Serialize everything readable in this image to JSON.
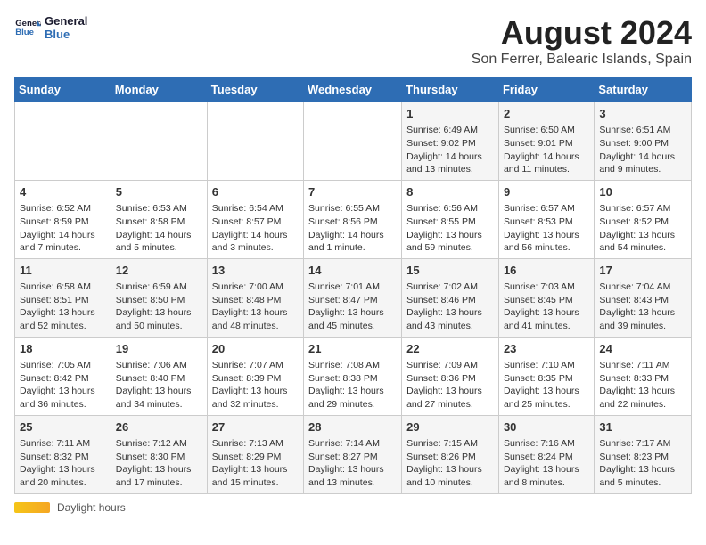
{
  "header": {
    "logo_line1": "General",
    "logo_line2": "Blue",
    "title": "August 2024",
    "subtitle": "Son Ferrer, Balearic Islands, Spain"
  },
  "days_of_week": [
    "Sunday",
    "Monday",
    "Tuesday",
    "Wednesday",
    "Thursday",
    "Friday",
    "Saturday"
  ],
  "weeks": [
    [
      {
        "day": "",
        "content": ""
      },
      {
        "day": "",
        "content": ""
      },
      {
        "day": "",
        "content": ""
      },
      {
        "day": "",
        "content": ""
      },
      {
        "day": "1",
        "content": "Sunrise: 6:49 AM\nSunset: 9:02 PM\nDaylight: 14 hours and 13 minutes."
      },
      {
        "day": "2",
        "content": "Sunrise: 6:50 AM\nSunset: 9:01 PM\nDaylight: 14 hours and 11 minutes."
      },
      {
        "day": "3",
        "content": "Sunrise: 6:51 AM\nSunset: 9:00 PM\nDaylight: 14 hours and 9 minutes."
      }
    ],
    [
      {
        "day": "4",
        "content": "Sunrise: 6:52 AM\nSunset: 8:59 PM\nDaylight: 14 hours and 7 minutes."
      },
      {
        "day": "5",
        "content": "Sunrise: 6:53 AM\nSunset: 8:58 PM\nDaylight: 14 hours and 5 minutes."
      },
      {
        "day": "6",
        "content": "Sunrise: 6:54 AM\nSunset: 8:57 PM\nDaylight: 14 hours and 3 minutes."
      },
      {
        "day": "7",
        "content": "Sunrise: 6:55 AM\nSunset: 8:56 PM\nDaylight: 14 hours and 1 minute."
      },
      {
        "day": "8",
        "content": "Sunrise: 6:56 AM\nSunset: 8:55 PM\nDaylight: 13 hours and 59 minutes."
      },
      {
        "day": "9",
        "content": "Sunrise: 6:57 AM\nSunset: 8:53 PM\nDaylight: 13 hours and 56 minutes."
      },
      {
        "day": "10",
        "content": "Sunrise: 6:57 AM\nSunset: 8:52 PM\nDaylight: 13 hours and 54 minutes."
      }
    ],
    [
      {
        "day": "11",
        "content": "Sunrise: 6:58 AM\nSunset: 8:51 PM\nDaylight: 13 hours and 52 minutes."
      },
      {
        "day": "12",
        "content": "Sunrise: 6:59 AM\nSunset: 8:50 PM\nDaylight: 13 hours and 50 minutes."
      },
      {
        "day": "13",
        "content": "Sunrise: 7:00 AM\nSunset: 8:48 PM\nDaylight: 13 hours and 48 minutes."
      },
      {
        "day": "14",
        "content": "Sunrise: 7:01 AM\nSunset: 8:47 PM\nDaylight: 13 hours and 45 minutes."
      },
      {
        "day": "15",
        "content": "Sunrise: 7:02 AM\nSunset: 8:46 PM\nDaylight: 13 hours and 43 minutes."
      },
      {
        "day": "16",
        "content": "Sunrise: 7:03 AM\nSunset: 8:45 PM\nDaylight: 13 hours and 41 minutes."
      },
      {
        "day": "17",
        "content": "Sunrise: 7:04 AM\nSunset: 8:43 PM\nDaylight: 13 hours and 39 minutes."
      }
    ],
    [
      {
        "day": "18",
        "content": "Sunrise: 7:05 AM\nSunset: 8:42 PM\nDaylight: 13 hours and 36 minutes."
      },
      {
        "day": "19",
        "content": "Sunrise: 7:06 AM\nSunset: 8:40 PM\nDaylight: 13 hours and 34 minutes."
      },
      {
        "day": "20",
        "content": "Sunrise: 7:07 AM\nSunset: 8:39 PM\nDaylight: 13 hours and 32 minutes."
      },
      {
        "day": "21",
        "content": "Sunrise: 7:08 AM\nSunset: 8:38 PM\nDaylight: 13 hours and 29 minutes."
      },
      {
        "day": "22",
        "content": "Sunrise: 7:09 AM\nSunset: 8:36 PM\nDaylight: 13 hours and 27 minutes."
      },
      {
        "day": "23",
        "content": "Sunrise: 7:10 AM\nSunset: 8:35 PM\nDaylight: 13 hours and 25 minutes."
      },
      {
        "day": "24",
        "content": "Sunrise: 7:11 AM\nSunset: 8:33 PM\nDaylight: 13 hours and 22 minutes."
      }
    ],
    [
      {
        "day": "25",
        "content": "Sunrise: 7:11 AM\nSunset: 8:32 PM\nDaylight: 13 hours and 20 minutes."
      },
      {
        "day": "26",
        "content": "Sunrise: 7:12 AM\nSunset: 8:30 PM\nDaylight: 13 hours and 17 minutes."
      },
      {
        "day": "27",
        "content": "Sunrise: 7:13 AM\nSunset: 8:29 PM\nDaylight: 13 hours and 15 minutes."
      },
      {
        "day": "28",
        "content": "Sunrise: 7:14 AM\nSunset: 8:27 PM\nDaylight: 13 hours and 13 minutes."
      },
      {
        "day": "29",
        "content": "Sunrise: 7:15 AM\nSunset: 8:26 PM\nDaylight: 13 hours and 10 minutes."
      },
      {
        "day": "30",
        "content": "Sunrise: 7:16 AM\nSunset: 8:24 PM\nDaylight: 13 hours and 8 minutes."
      },
      {
        "day": "31",
        "content": "Sunrise: 7:17 AM\nSunset: 8:23 PM\nDaylight: 13 hours and 5 minutes."
      }
    ]
  ],
  "footer": {
    "daylight_label": "Daylight hours"
  }
}
